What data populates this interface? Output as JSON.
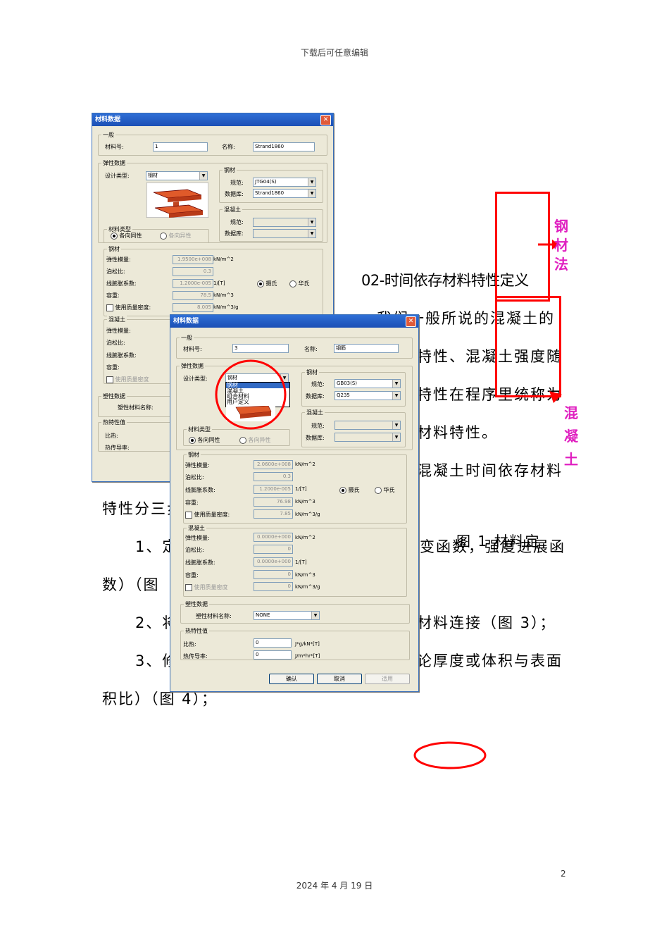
{
  "header": "下载后可任意编辑",
  "footer_date": "2024 年 4 月 19 日",
  "page_number": "2",
  "doc_title": "02-时间依存材料特性定义",
  "paragraphs": {
    "p1": "我们一般所说的混凝土的",
    "p2": "特性、混凝土强度随",
    "p3": "特性在程序里统称为",
    "p4": "材料特性。",
    "p5": "混凝土时间依存材料",
    "p6": "特性分三步",
    "p7a": "1、定",
    "p7b": "变函数，强度进展函",
    "p8": "数）（图",
    "p9a": "2、将",
    "p9b": "材料连接（图 3）；",
    "p10a": "3、修",
    "p10b": "论厚度或体积与表面",
    "p11": "积比）（图 4）；",
    "caption": "图 1 材料定"
  },
  "annotations": {
    "steel_method": [
      "钢",
      "材",
      "法"
    ],
    "concrete": [
      "混",
      "凝",
      "土"
    ]
  },
  "dialog1": {
    "title": "材料数据",
    "general": "一般",
    "material_no_label": "材料号:",
    "material_no": "1",
    "name_label": "名称:",
    "name": "Strand1860",
    "elastic": "弹性数据",
    "design_type_label": "设计类型:",
    "design_type": "钢材",
    "steel_group": "钢材",
    "code_label": "规范:",
    "code": "JTG04(S)",
    "db_label": "数据库:",
    "db": "Strand1860",
    "concrete_group": "混凝土",
    "code2_label": "规范:",
    "db2_label": "数据库:",
    "mat_type": "材料类型",
    "isotropic": "各向同性",
    "anisotropic": "各向异性",
    "steel_sec": "钢材",
    "E_label": "弹性模量:",
    "E": "1.9500e+008",
    "E_unit": "kN/m^2",
    "nu_label": "泊松比:",
    "nu": "0.3",
    "alpha_label": "线膨胀系数:",
    "alpha": "1.2000e-005",
    "alpha_unit": "1/[T]",
    "celsius": "摄氏",
    "fahrenheit": "华氏",
    "w_label": "容重:",
    "w": "78.5",
    "w_unit": "kN/m^3",
    "mass_label": "使用质量密度:",
    "mass": "8.005",
    "mass_unit": "kN/m^3/g",
    "conc_sec": "混凝土",
    "cE_label": "弹性模量:",
    "cnu_label": "泊松比:",
    "calpha_label": "线膨胀系数:",
    "cw_label": "容重:",
    "cmass_label": "使用质量密度",
    "plastic": "塑性数据",
    "plastic_name_label": "塑性材料名称:",
    "thermal": "热特性值",
    "sh_label": "比热:",
    "tc_label": "热传导率:"
  },
  "dialog2": {
    "title": "材料数据",
    "general": "一般",
    "material_no_label": "材料号:",
    "material_no": "3",
    "name_label": "名称:",
    "name": "钢筋",
    "elastic": "弹性数据",
    "design_type_label": "设计类型:",
    "design_type": "钢材",
    "design_options": [
      "钢材",
      "混凝土",
      "组合材料",
      "用户定义"
    ],
    "steel_group": "钢材",
    "code_label": "规范:",
    "code": "GB03(S)",
    "db_label": "数据库:",
    "db": "Q235",
    "concrete_group": "混凝土",
    "code2_label": "规范:",
    "db2_label": "数据库:",
    "mat_type": "材料类型",
    "isotropic": "各向同性",
    "anisotropic": "各向异性",
    "steel_sec": "钢材",
    "E_label": "弹性模量:",
    "E": "2.0600e+008",
    "E_unit": "kN/m^2",
    "nu_label": "泊松比:",
    "nu": "0.3",
    "alpha_label": "线膨胀系数:",
    "alpha": "1.2000e-005",
    "alpha_unit": "1/[T]",
    "celsius": "摄氏",
    "fahrenheit": "华氏",
    "w_label": "容重:",
    "w": "76.98",
    "w_unit": "kN/m^3",
    "mass_label": "使用质量密度:",
    "mass": "7.85",
    "mass_unit": "kN/m^3/g",
    "conc_sec": "混凝土",
    "cE_label": "弹性模量:",
    "cE": "0.0000e+000",
    "cE_unit": "kN/m^2",
    "cnu_label": "泊松比:",
    "cnu": "0",
    "calpha_label": "线膨胀系数:",
    "calpha": "0.0000e+000",
    "calpha_unit": "1/[T]",
    "cw_label": "容重:",
    "cw": "0",
    "cw_unit": "kN/m^3",
    "cmass_label": "使用质量密度",
    "cmass": "0",
    "cmass_unit": "kN/m^3/g",
    "plastic": "塑性数据",
    "plastic_name_label": "塑性材料名称:",
    "plastic_name": "NONE",
    "thermal": "热特性值",
    "sh_label": "比热:",
    "sh": "0",
    "sh_unit": "J*g/kN*[T]",
    "tc_label": "热传导率:",
    "tc": "0",
    "tc_unit": "J/m*hr*[T]",
    "ok": "确认",
    "cancel": "取消",
    "apply": "适用"
  },
  "colors": {
    "annotation_red": "#ff0000",
    "annotation_magenta": "#e020c0",
    "titlebar": "#2f6fd6",
    "dialog_bg": "#ece9d8"
  }
}
